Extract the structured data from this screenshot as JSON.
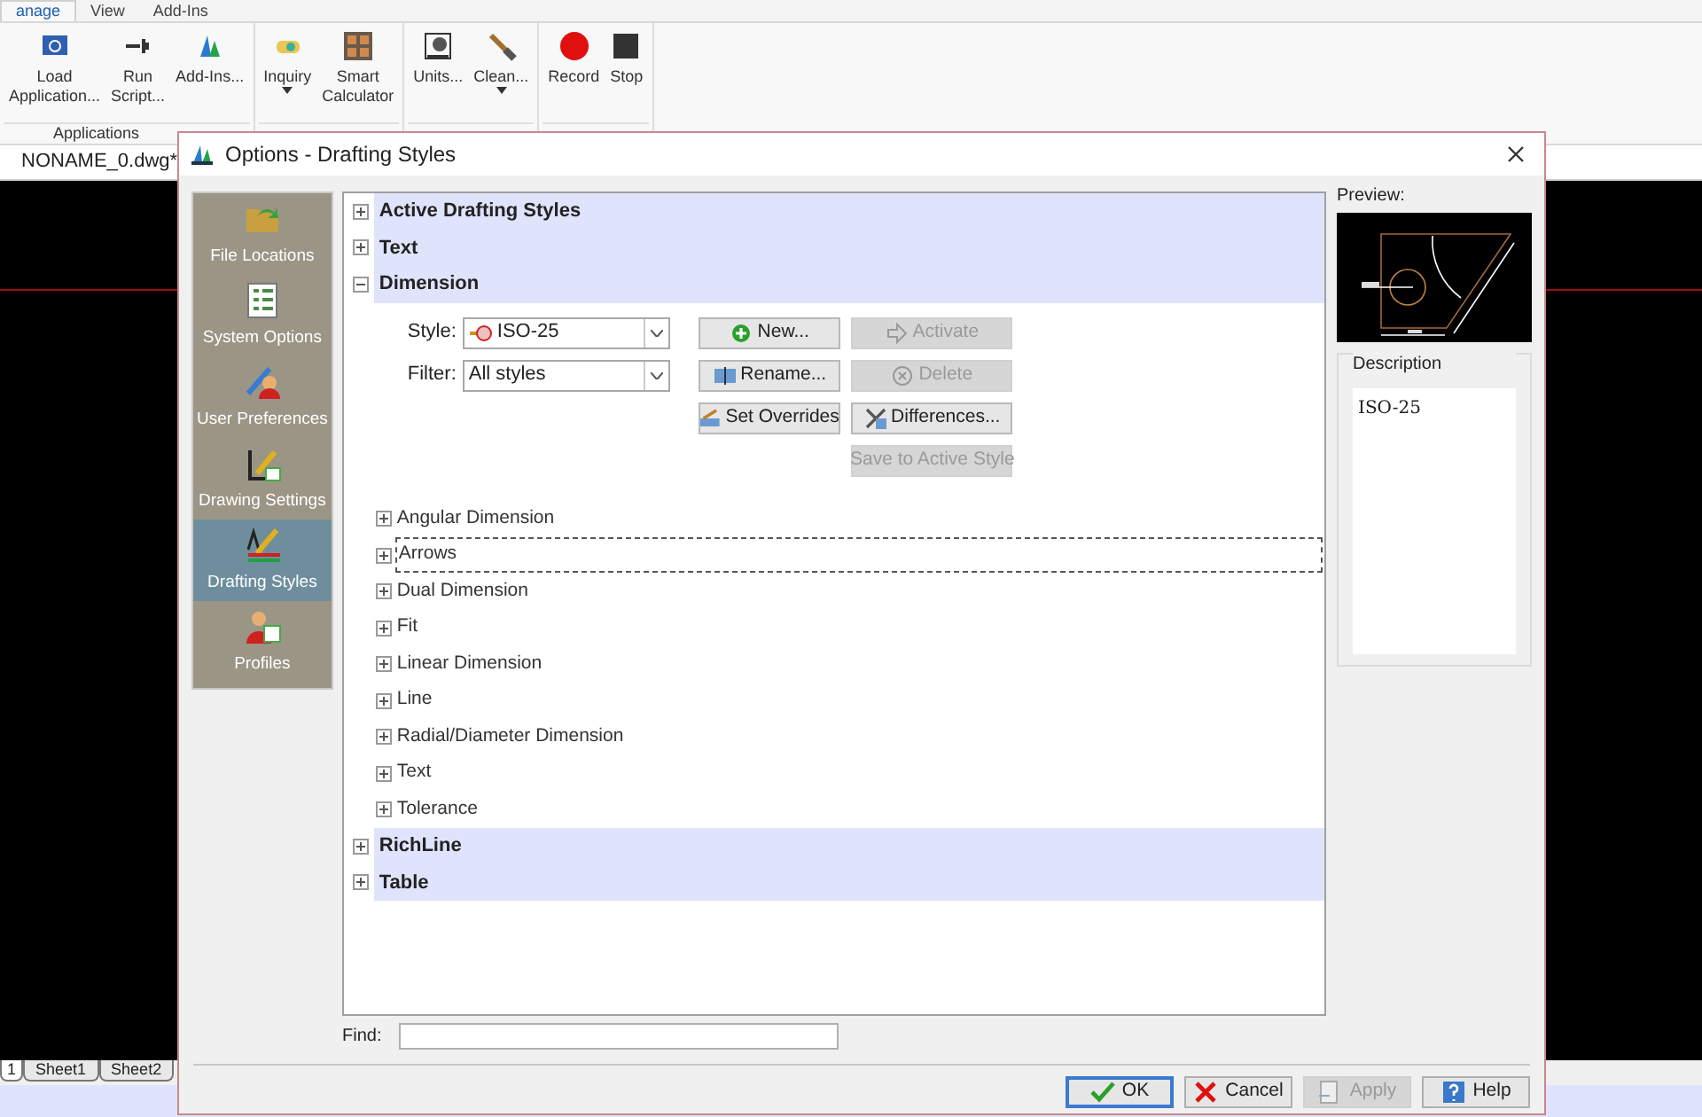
{
  "ribbon": {
    "tabs": [
      {
        "label": "anage",
        "selected": true
      },
      {
        "label": "View",
        "selected": false
      },
      {
        "label": "Add-Ins",
        "selected": false
      }
    ],
    "groups": [
      {
        "label": "Applications",
        "buttons": [
          {
            "label": "Load Application...",
            "dropdown": false
          },
          {
            "label": "Run Script...",
            "dropdown": false
          },
          {
            "label": "Add-Ins...",
            "dropdown": false
          }
        ]
      },
      {
        "buttons": [
          {
            "label": "Inquiry",
            "dropdown": true
          },
          {
            "label": "Smart Calculator",
            "dropdown": false
          }
        ]
      },
      {
        "buttons": [
          {
            "label": "Units...",
            "dropdown": false
          },
          {
            "label": "Clean...",
            "dropdown": true
          }
        ]
      },
      {
        "buttons": [
          {
            "label": "Record",
            "dropdown": false
          },
          {
            "label": "Stop",
            "dropdown": false
          }
        ]
      }
    ]
  },
  "document_tab": "NONAME_0.dwg*",
  "sheet_tabs": [
    {
      "label": "1",
      "selected": true
    },
    {
      "label": "Sheet1",
      "selected": false
    },
    {
      "label": "Sheet2",
      "selected": false
    }
  ],
  "dialog": {
    "title": "Options - Drafting Styles",
    "sidebar": [
      {
        "label": "File Locations",
        "selected": false
      },
      {
        "label": "System Options",
        "selected": false
      },
      {
        "label": "User Preferences",
        "selected": false
      },
      {
        "label": "Drawing Settings",
        "selected": false
      },
      {
        "label": "Drafting Styles",
        "selected": true
      },
      {
        "label": "Profiles",
        "selected": false
      }
    ],
    "tree": [
      {
        "label": "Active Drafting Styles",
        "expanded": false
      },
      {
        "label": "Text",
        "expanded": false
      },
      {
        "label": "Dimension",
        "expanded": true,
        "style_label": "Style:",
        "style_value": "ISO-25",
        "filter_label": "Filter:",
        "filter_value": "All styles",
        "buttons": [
          {
            "label": "New...",
            "disabled": false
          },
          {
            "label": "Activate",
            "disabled": true
          },
          {
            "label": "Rename...",
            "disabled": false
          },
          {
            "label": "Delete",
            "disabled": true
          },
          {
            "label": "Set Overrides",
            "disabled": false
          },
          {
            "label": "Differences...",
            "disabled": false
          },
          {
            "label": "Save to Active Style",
            "disabled": true
          }
        ],
        "children": [
          {
            "label": "Angular Dimension",
            "focused": false
          },
          {
            "label": "Arrows",
            "focused": true
          },
          {
            "label": "Dual Dimension",
            "focused": false
          },
          {
            "label": "Fit",
            "focused": false
          },
          {
            "label": "Linear Dimension",
            "focused": false
          },
          {
            "label": "Line",
            "focused": false
          },
          {
            "label": "Radial/Diameter Dimension",
            "focused": false
          },
          {
            "label": "Text",
            "focused": false
          },
          {
            "label": "Tolerance",
            "focused": false
          }
        ]
      },
      {
        "label": "RichLine",
        "expanded": false
      },
      {
        "label": "Table",
        "expanded": false
      }
    ],
    "preview_label": "Preview:",
    "description_label": "Description",
    "description": "ISO-25",
    "find_label": "Find:",
    "footer_buttons": [
      {
        "label": "OK",
        "disabled": false,
        "default": true
      },
      {
        "label": "Cancel",
        "disabled": false,
        "default": false
      },
      {
        "label": "Apply",
        "disabled": true,
        "default": false
      },
      {
        "label": "Help",
        "disabled": false,
        "default": false
      }
    ]
  }
}
